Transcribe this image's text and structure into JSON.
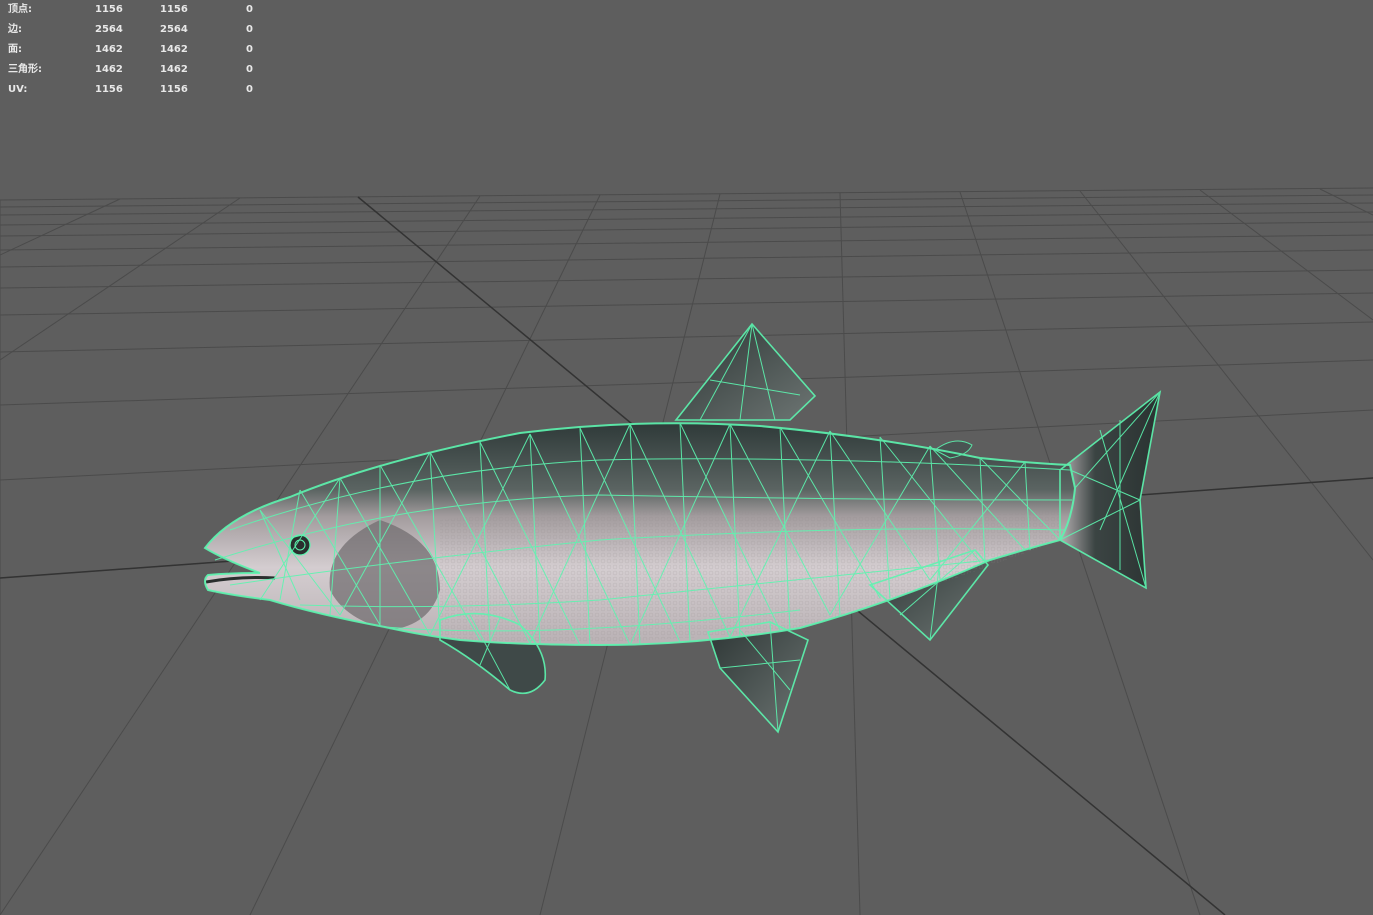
{
  "hud": {
    "rows": [
      {
        "label": "顶点:",
        "total": "1156",
        "selected": "1156",
        "extra": "0"
      },
      {
        "label": "边:",
        "total": "2564",
        "selected": "2564",
        "extra": "0"
      },
      {
        "label": "面:",
        "total": "1462",
        "selected": "1462",
        "extra": "0"
      },
      {
        "label": "三角形:",
        "total": "1462",
        "selected": "1462",
        "extra": "0"
      },
      {
        "label": "UV:",
        "total": "1156",
        "selected": "1156",
        "extra": "0"
      }
    ]
  },
  "colors": {
    "background": "#5e5e5e",
    "grid": "#4a4a4a",
    "grid_axis": "#3a3a3a",
    "wireframe": "#5df5b0",
    "body_light": "#c9c2c4",
    "body_dark": "#3d4a48"
  },
  "object": {
    "name": "salmon-mesh"
  }
}
